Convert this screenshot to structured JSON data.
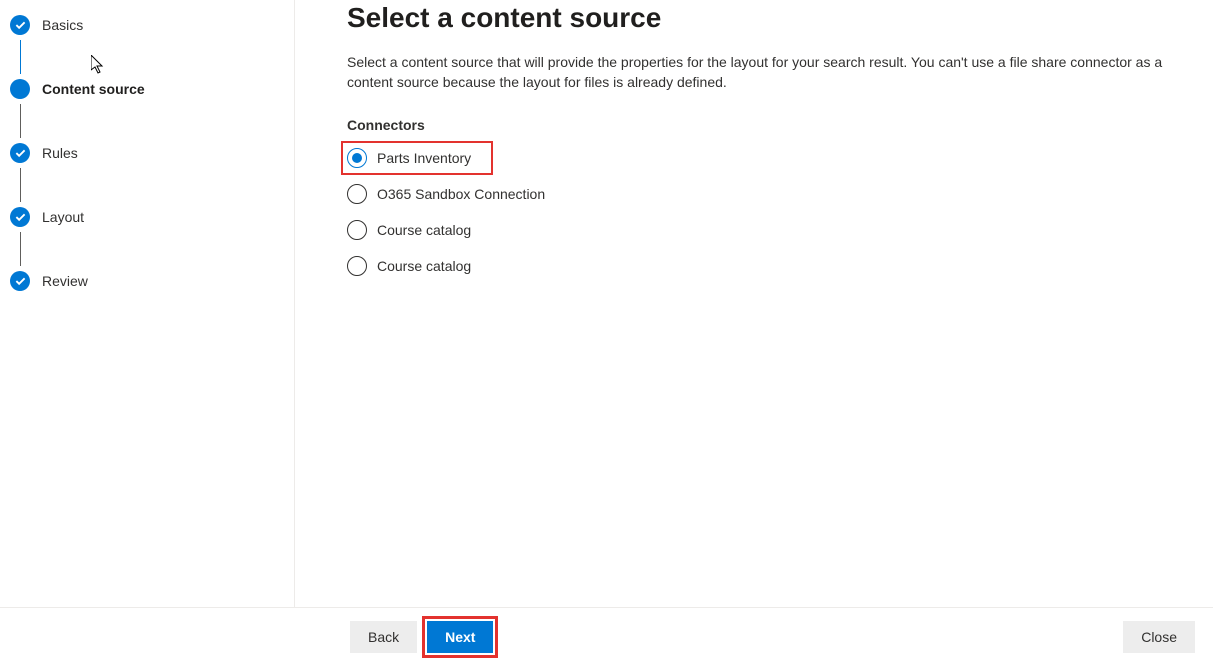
{
  "steps": [
    {
      "label": "Basics",
      "state": "completed"
    },
    {
      "label": "Content source",
      "state": "current"
    },
    {
      "label": "Rules",
      "state": "completed"
    },
    {
      "label": "Layout",
      "state": "completed"
    },
    {
      "label": "Review",
      "state": "completed"
    }
  ],
  "page": {
    "title": "Select a content source",
    "description": "Select a content source that will provide the properties for the layout for your search result. You can't use a file share connector as a content source because the layout for files is already defined."
  },
  "connectors": {
    "label": "Connectors",
    "options": [
      {
        "label": "Parts Inventory",
        "selected": true,
        "highlighted": true
      },
      {
        "label": "O365 Sandbox Connection",
        "selected": false,
        "highlighted": false
      },
      {
        "label": "Course catalog",
        "selected": false,
        "highlighted": false
      },
      {
        "label": "Course catalog",
        "selected": false,
        "highlighted": false
      }
    ]
  },
  "footer": {
    "back": "Back",
    "next": "Next",
    "close": "Close"
  }
}
